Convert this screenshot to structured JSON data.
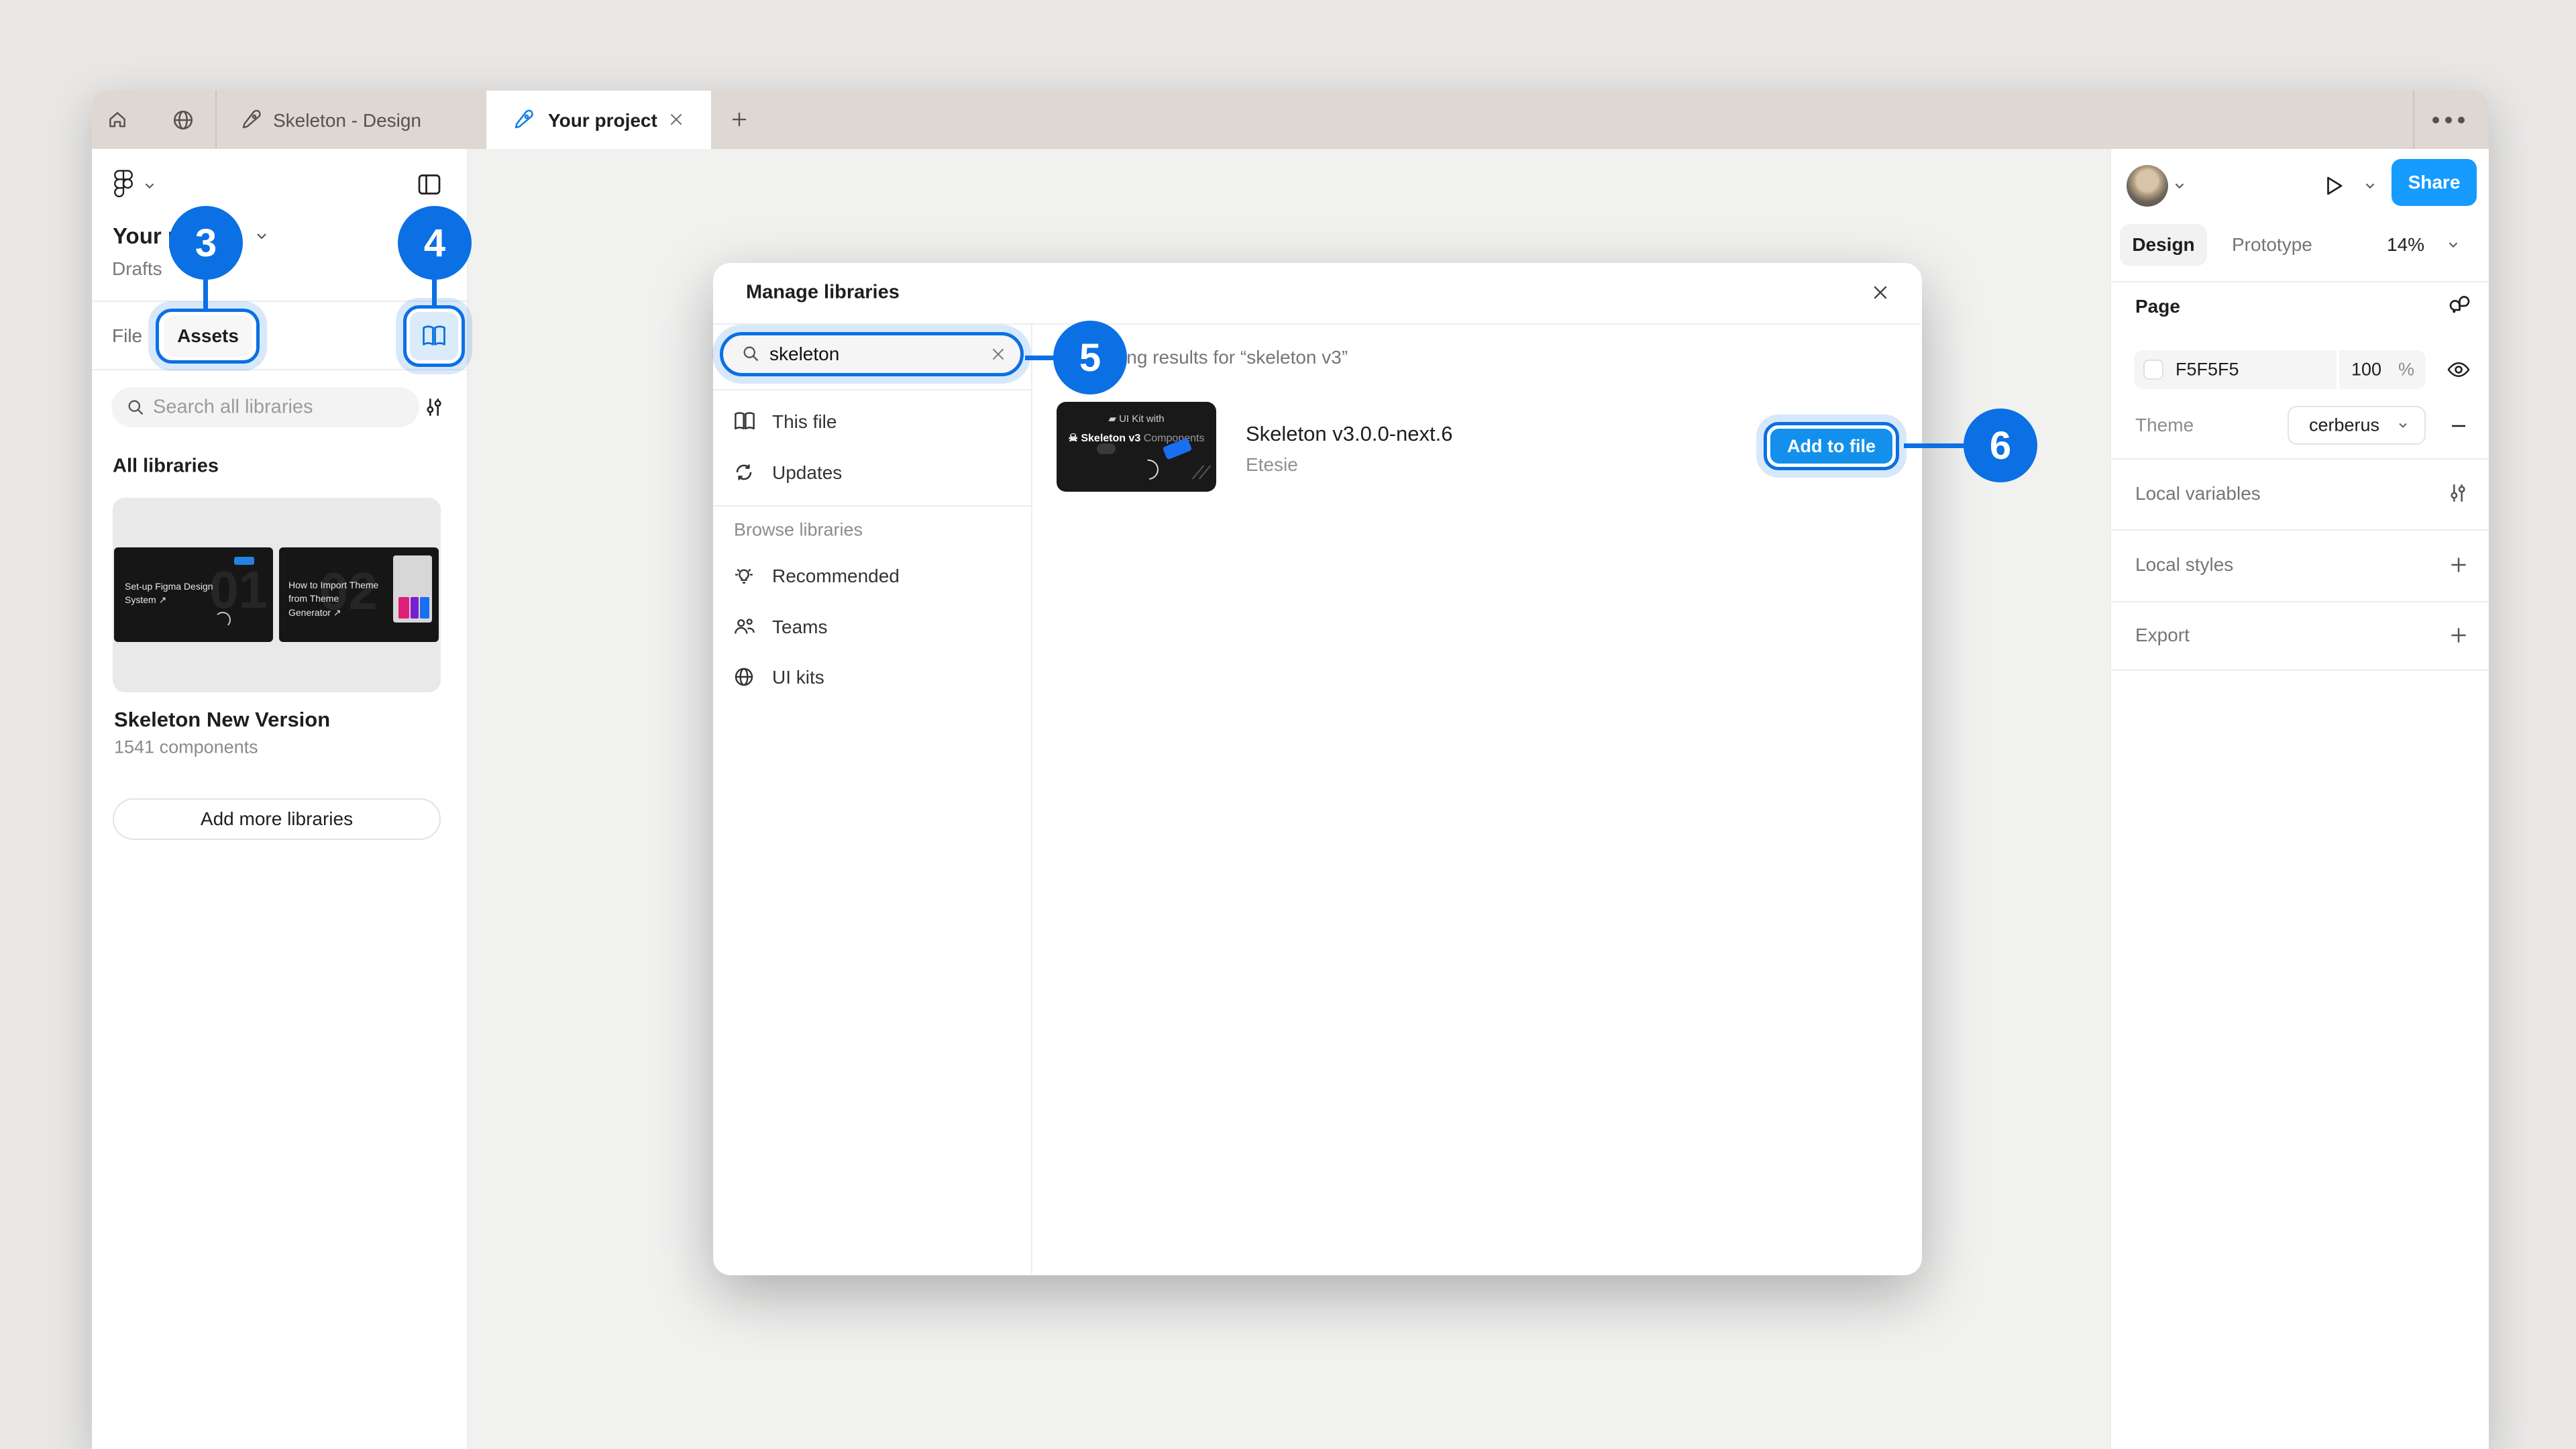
{
  "tabbar": {
    "tab1": "Skeleton - Design",
    "tab2": "Your project"
  },
  "sidebar": {
    "title": "Your project",
    "subtitle": "Drafts",
    "tab_file": "File",
    "tab_assets": "Assets",
    "search_placeholder": "Search all libraries",
    "all_libraries": "All libraries",
    "card": {
      "title": "Skeleton New Version",
      "subtitle": "1541 components",
      "thumb1_label": "Set-up Figma Design System ↗",
      "thumb1_num": "01",
      "thumb2_label": "How to Import Theme from Theme Generator ↗",
      "thumb2_num": "02"
    },
    "add_more": "Add more libraries"
  },
  "modal": {
    "title": "Manage libraries",
    "search_value": "skeleton",
    "nav": {
      "this_file": "This file",
      "updates": "Updates",
      "browse_label": "Browse libraries",
      "recommended": "Recommended",
      "teams": "Teams",
      "ui_kits": "UI kits"
    },
    "results_heading": "Showing results for “skeleton v3”",
    "result": {
      "title": "Skeleton v3.0.0-next.6",
      "author": "Etesie",
      "action": "Add to file",
      "thumb_line1": "UI Kit with",
      "thumb_line2a": "Skeleton v3",
      "thumb_line2b": "Components"
    }
  },
  "inspector": {
    "share": "Share",
    "design": "Design",
    "prototype": "Prototype",
    "zoom": "14%",
    "page_label": "Page",
    "fill_hex": "F5F5F5",
    "fill_opacity": "100",
    "percent": "%",
    "theme_label": "Theme",
    "theme_value": "cerberus",
    "local_variables": "Local variables",
    "local_styles": "Local styles",
    "export_label": "Export"
  },
  "annotations": {
    "b3": "3",
    "b4": "4",
    "b5": "5",
    "b6": "6"
  },
  "colors": {
    "accent": "#0b70e4",
    "share_blue": "#169bff",
    "add_blue": "#1290ec",
    "tabbar": "#ded7d2"
  }
}
